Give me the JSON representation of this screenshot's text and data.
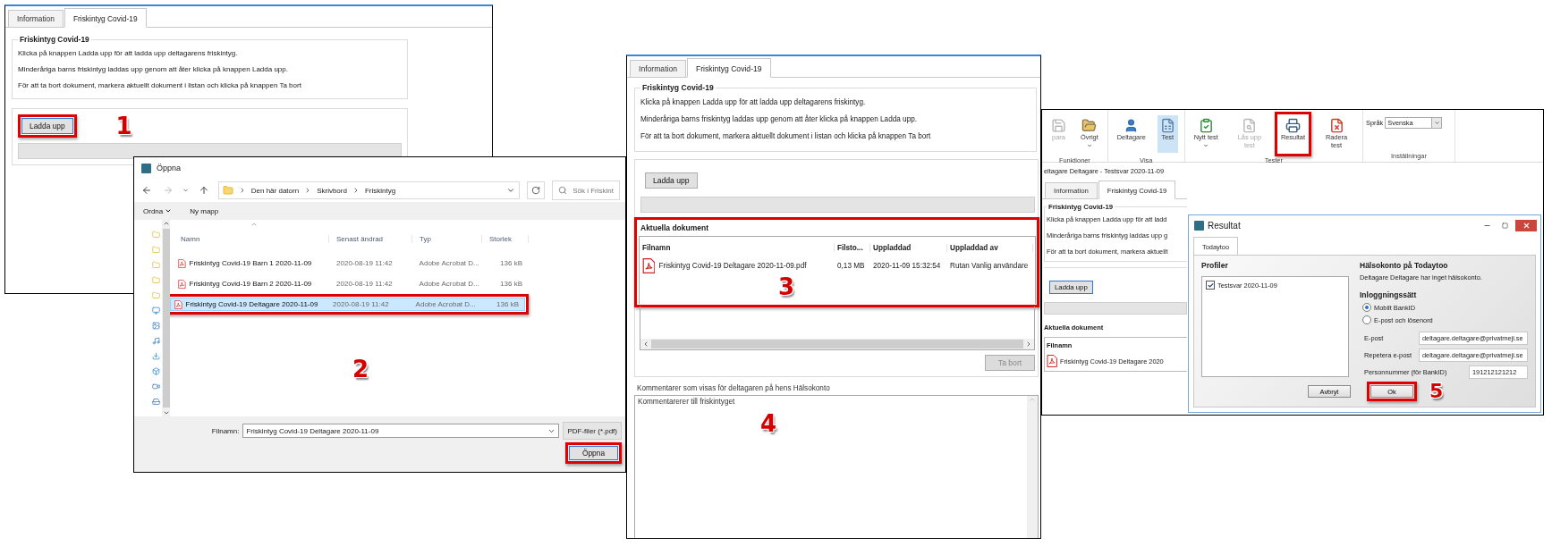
{
  "upload_window": {
    "tabs": [
      {
        "label": "Information",
        "selected": false
      },
      {
        "label": "Friskintyg Covid-19",
        "selected": true
      }
    ],
    "group_title": "Friskintyg Covid-19",
    "instructions": [
      "Klicka på knappen Ladda upp för att ladda upp deltagarens friskintyg.",
      "Minderåriga barns friskintyg laddas upp genom att åter klicka på knappen Ladda upp.",
      "För att ta bort dokument, markera aktuellt dokument i listan och klicka på knappen Ta bort"
    ],
    "upload_button": {
      "label": "Ladda upp",
      "highlighted": true
    },
    "callout": "1"
  },
  "open_dialog": {
    "title": "Öppna",
    "path": [
      "Den här datorn",
      "Skrivbord",
      "Friskintyg"
    ],
    "search": {
      "placeholder": "Sök i Friskint"
    },
    "toolbar": [
      {
        "label": "Ordna",
        "kind": "menu"
      },
      {
        "label": "Ny mapp",
        "kind": "button"
      }
    ],
    "columns": [
      "Namn",
      "Senast ändrad",
      "Typ",
      "Storlek"
    ],
    "rows": [
      {
        "cells": [
          "Friskintyg Covid-19 Barn 1 2020-11-09",
          "2020-08-19 11:42",
          "Adobe Acrobat D...",
          "136 kB"
        ],
        "selected": false,
        "highlighted": false
      },
      {
        "cells": [
          "Friskintyg Covid-19 Barn 2 2020-11-09",
          "2020-08-19 11:42",
          "Adobe Acrobat D...",
          "136 kB"
        ],
        "selected": false,
        "highlighted": false
      },
      {
        "cells": [
          "Friskintyg Covid-19 Deltagare 2020-11-09",
          "2020-08-19 11:42",
          "Adobe Acrobat D...",
          "136 kB"
        ],
        "selected": true,
        "highlighted": true
      }
    ],
    "callout": "2",
    "filename_label": "Filnamn:",
    "filename": "Friskintyg Covid-19 Deltagare 2020-11-09",
    "filetype": "PDF-filer (*.pdf)",
    "open_button": {
      "label": "Öppna",
      "highlighted": true
    }
  },
  "document_window": {
    "tabs": [
      {
        "label": "Information",
        "selected": false
      },
      {
        "label": "Friskintyg Covid-19",
        "selected": true
      }
    ],
    "group_title": "Friskintyg Covid-19",
    "instructions": [
      "Klicka på knappen Ladda upp för att ladda upp deltagarens friskintyg.",
      "Minderåriga barns friskintyg laddas upp genom att åter klicka på knappen Ladda upp.",
      "För att ta bort dokument, markera aktuellt dokument i listan och klicka på knappen Ta bort"
    ],
    "upload_button": {
      "label": "Ladda upp",
      "highlighted": false
    },
    "documents": {
      "title": "Aktuella dokument",
      "highlighted": true,
      "columns": [
        "Filnamn",
        "Filsto...",
        "Uppladdad",
        "Uppladdad av"
      ],
      "rows": [
        {
          "cells": [
            "Friskintyg Covid-19 Deltagare 2020-11-09.pdf",
            "0,13 MB",
            "2020-11-09 15:32:54",
            "Rutan Vanlig användare"
          ]
        }
      ],
      "callout": "3"
    },
    "delete_button": {
      "label": "Ta bort",
      "disabled": true
    },
    "comments": {
      "label": "Kommentarer som visas för deltagaren på hens Hälsokonto",
      "value": "Kommentarerer till friskintyget",
      "callout": "4"
    }
  },
  "main_window": {
    "ribbon": [
      {
        "label": "Funktioner",
        "items": [
          {
            "label": "para",
            "kind": "save",
            "selected": false,
            "disabled": true,
            "dropdown": false,
            "highlighted": false
          },
          {
            "label": "Övrigt",
            "kind": "folder",
            "selected": false,
            "disabled": false,
            "dropdown": true,
            "highlighted": false
          }
        ]
      },
      {
        "label": "Visa",
        "items": [
          {
            "label": "Deltagare",
            "kind": "person",
            "selected": false,
            "disabled": false,
            "dropdown": false,
            "highlighted": false
          },
          {
            "label": "Test",
            "kind": "sheet",
            "selected": true,
            "disabled": false,
            "dropdown": false,
            "highlighted": false
          }
        ]
      },
      {
        "label": "Tester",
        "items": [
          {
            "label": "Nytt test",
            "kind": "new",
            "selected": false,
            "disabled": false,
            "dropdown": true,
            "highlighted": false
          },
          {
            "label": "Lås upp test",
            "kind": "unlock",
            "selected": false,
            "disabled": true,
            "dropdown": false,
            "highlighted": false
          },
          {
            "label": "Resultat",
            "kind": "print",
            "selected": false,
            "disabled": false,
            "dropdown": false,
            "highlighted": true
          },
          {
            "label": "Radera test",
            "kind": "delete",
            "selected": false,
            "disabled": false,
            "dropdown": false,
            "highlighted": false
          }
        ]
      },
      {
        "label": "Inställningar",
        "language": {
          "label": "Språk",
          "value": "Svenska"
        }
      }
    ],
    "breadcrumb": "eltagare Deltagare - Testsvar 2020-11-09",
    "tabs": [
      {
        "label": "Information",
        "selected": false
      },
      {
        "label": "Friskintyg Covid-19",
        "selected": true
      }
    ],
    "group_title": "Friskintyg Covid-19",
    "instructions": [
      "Klicka på knappen Ladda upp för att ladd",
      "Minderåriga barns friskintyg laddas upp g",
      "För att ta bort dokument, markera aktuellt"
    ],
    "upload_button": {
      "label": "Ladda upp",
      "highlighted": false
    },
    "documents": {
      "title": "Aktuella dokument",
      "columns": [
        "Filnamn"
      ],
      "rows": [
        {
          "cells": [
            "Friskintyg Covid-19 Deltagare 2020"
          ]
        }
      ]
    }
  },
  "result_dialog": {
    "title": "Resultat",
    "tabs": [
      {
        "label": "Todaytoo",
        "selected": true
      }
    ],
    "profiles_title": "Profiler",
    "profiles": [
      {
        "label": "Testsvar 2020-11-09",
        "checked": true
      }
    ],
    "account_title": "Hälsokonto på Todaytoo",
    "account_status": "Deltagare Deltagare har inget hälsokonto.",
    "login_title": "Inloggningssätt",
    "login_options": [
      {
        "label": "Mobilt BankID",
        "selected": true
      },
      {
        "label": "E-post och lösenord",
        "selected": false
      }
    ],
    "fields": [
      {
        "label": "E-post",
        "value": "deltagare.deltagare@privatmeji.se"
      },
      {
        "label": "Repetera e-post",
        "value": "deltagare.deltagare@privatmeji.se"
      },
      {
        "label": "Personnummer (för BankID)",
        "value": "191212121212"
      }
    ],
    "buttons": [
      {
        "label": "Avbryt",
        "highlighted": false
      },
      {
        "label": "Ok",
        "highlighted": true
      }
    ],
    "callout": "5"
  }
}
